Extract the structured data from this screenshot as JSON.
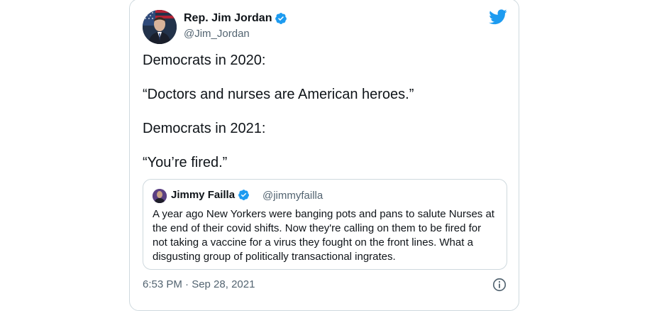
{
  "author": {
    "name": "Rep. Jim Jordan",
    "handle": "@Jim_Jordan"
  },
  "tweet": {
    "lines": [
      "Democrats in 2020:",
      "“Doctors and nurses are American heroes.”",
      "Democrats in 2021:",
      "“You’re fired.”"
    ],
    "timestamp": "6:53 PM · Sep 28, 2021"
  },
  "quoted_tweet": {
    "name": "Jimmy Failla",
    "handle": "@jimmyfailla",
    "text": "A year ago New Yorkers were banging pots and pans to salute Nurses at the end of their covid shifts. Now they're calling on them to be fired for not taking a vaccine for a virus they fought on the front lines. What a disgusting group of politically transactional ingrates."
  },
  "colors": {
    "twitter_blue": "#1d9bf0",
    "text_primary": "#0f1419",
    "text_secondary": "#536471",
    "border": "#cfd9de"
  },
  "icons": [
    "twitter-logo-icon",
    "verified-badge-icon",
    "info-icon"
  ]
}
